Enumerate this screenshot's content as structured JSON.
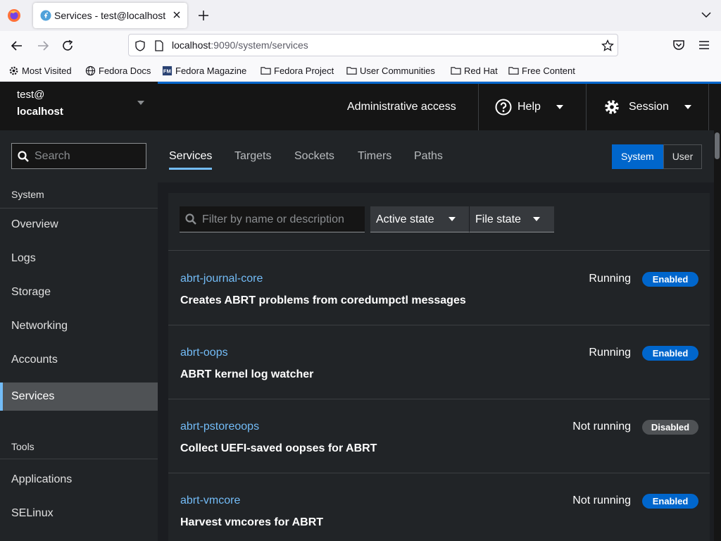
{
  "browser": {
    "tab_title": "Services - test@localhost",
    "url_host": "localhost",
    "url_rest": ":9090/system/services",
    "bookmarks": [
      "Most Visited",
      "Fedora Docs",
      "Fedora Magazine",
      "Fedora Project",
      "User Communities",
      "Red Hat",
      "Free Content"
    ]
  },
  "host": {
    "user": "test@",
    "name": "localhost"
  },
  "sidebar": {
    "search_placeholder": "Search",
    "system_title": "System",
    "system_items": [
      "Overview",
      "Logs",
      "Storage",
      "Networking",
      "Accounts",
      "Services"
    ],
    "active_item": "Services",
    "tools_title": "Tools",
    "tools_items": [
      "Applications",
      "SELinux"
    ]
  },
  "masthead": {
    "admin": "Administrative access",
    "help": "Help",
    "session": "Session"
  },
  "subnav": {
    "tabs": [
      "Services",
      "Targets",
      "Sockets",
      "Timers",
      "Paths"
    ],
    "active_tab": "Services",
    "toggle": [
      "System",
      "User"
    ],
    "toggle_active": "System"
  },
  "filters": {
    "placeholder": "Filter by name or description",
    "active_state": "Active state",
    "file_state": "File state"
  },
  "services": [
    {
      "name": "abrt-journal-core",
      "desc": "Creates ABRT problems from coredumpctl messages",
      "state": "Running",
      "file_state": "Enabled"
    },
    {
      "name": "abrt-oops",
      "desc": "ABRT kernel log watcher",
      "state": "Running",
      "file_state": "Enabled"
    },
    {
      "name": "abrt-pstoreoops",
      "desc": "Collect UEFI-saved oopses for ABRT",
      "state": "Not running",
      "file_state": "Disabled"
    },
    {
      "name": "abrt-vmcore",
      "desc": "Harvest vmcores for ABRT",
      "state": "Not running",
      "file_state": "Enabled"
    }
  ],
  "colors": {
    "accent": "#0066cc",
    "link": "#73bcf7",
    "nav_active": "#4f5255"
  }
}
